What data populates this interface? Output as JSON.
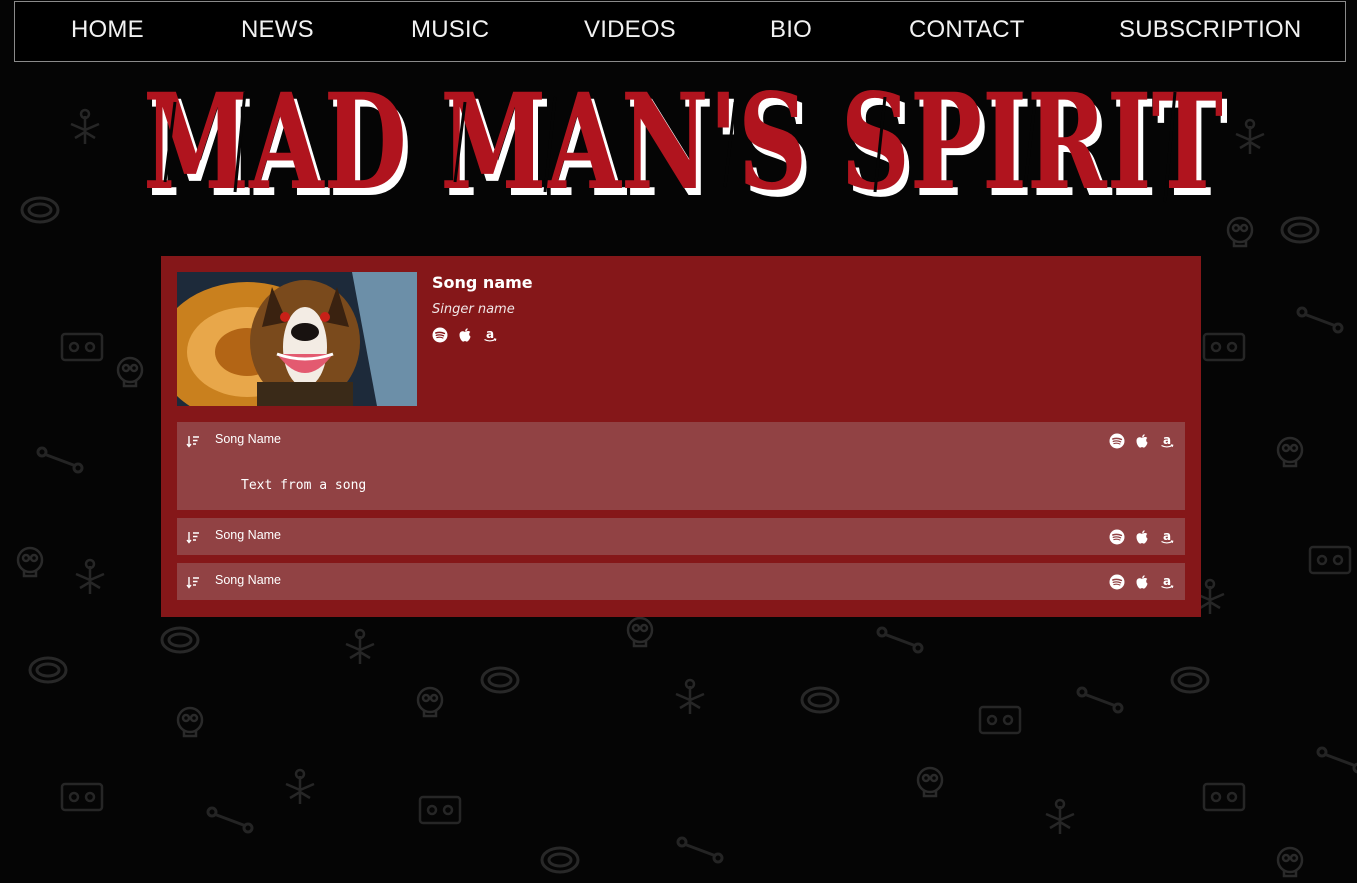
{
  "nav": {
    "items": [
      {
        "label": "HOME"
      },
      {
        "label": "NEWS"
      },
      {
        "label": "MUSIC"
      },
      {
        "label": "VIDEOS"
      },
      {
        "label": "BIO"
      },
      {
        "label": "CONTACT"
      },
      {
        "label": "SUBSCRIPTION"
      }
    ]
  },
  "logo": {
    "text": "MAD MAN'S SPIRIT"
  },
  "player": {
    "song_name": "Song name",
    "singer_name": "Singer name",
    "tracks": [
      {
        "name": "Song Name",
        "lyrics": "Text from a song"
      },
      {
        "name": "Song Name"
      },
      {
        "name": "Song Name"
      }
    ]
  },
  "icons": {
    "streaming": [
      "spotify-icon",
      "apple-music-icon",
      "amazon-music-icon"
    ],
    "sort": "sort-desc-icon"
  },
  "colors": {
    "background": "#050505",
    "panel": "#851719",
    "track_row": "#914244",
    "logo_red": "#b0141e"
  }
}
